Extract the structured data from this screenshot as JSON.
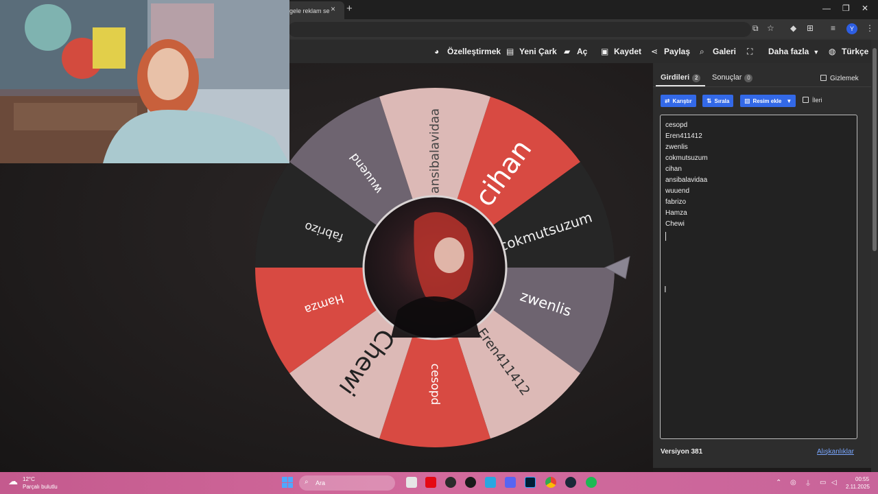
{
  "browser": {
    "tab_title": "gele reklam se",
    "tab_close": "×",
    "new_tab": "+",
    "minimize": "—",
    "restore": "❐",
    "close": "✕",
    "profile_initial": "Y"
  },
  "nav": {
    "customize": "Özelleştirmek",
    "new_wheel": "Yeni Çark",
    "open": "Aç",
    "save": "Kaydet",
    "share": "Paylaş",
    "gallery": "Galeri",
    "more": "Daha fazla",
    "language": "Türkçe"
  },
  "panel": {
    "tabs": [
      {
        "label": "Girdileri",
        "count": "2"
      },
      {
        "label": "Sonuçlar",
        "count": "0"
      }
    ],
    "hide_label": "Gizlemek",
    "shuffle_label": "Karıştır",
    "sort_label": "Sırala",
    "add_image_label": "Resim ekle",
    "advanced_label": "İleri",
    "entries": [
      "cesopd",
      "Eren411412",
      "zwenlis",
      "cokmutsuzum",
      "cihan",
      "ansibalavidaa",
      "wuuend",
      "fabrizo",
      "Hamza",
      "Chewi"
    ],
    "version": "Versiyon 381",
    "shortcuts": "Alışkanlıklar"
  },
  "wheel": {
    "segments": [
      {
        "label": "cihan",
        "color": "#d84a42",
        "text": "#ffffff",
        "size": 40
      },
      {
        "label": "cokmutsuzum",
        "color": "#262626",
        "text": "#f0f0f0",
        "size": 20
      },
      {
        "label": "zwenlis",
        "color": "#6e6470",
        "text": "#ffffff",
        "size": 21
      },
      {
        "label": "Eren411412",
        "color": "#dcb9b6",
        "text": "#333333",
        "size": 19
      },
      {
        "label": "cesopd",
        "color": "#d84a42",
        "text": "#ffffff",
        "size": 17
      },
      {
        "label": "Chewi",
        "color": "#dcb9b6",
        "text": "#222222",
        "size": 36
      },
      {
        "label": "Hamza",
        "color": "#d84a42",
        "text": "#ffffff",
        "size": 17
      },
      {
        "label": "fabrizo",
        "color": "#262626",
        "text": "#f0f0f0",
        "size": 17
      },
      {
        "label": "wuuend",
        "color": "#6e6470",
        "text": "#ffffff",
        "size": 17
      },
      {
        "label": "ansibalavidaa",
        "color": "#dcb9b6",
        "text": "#444444",
        "size": 18
      }
    ]
  },
  "taskbar": {
    "temperature": "12°C",
    "weather": "Parçalı bulutlu",
    "search": "Ara",
    "time": "00:55",
    "date": "2.11.2025"
  }
}
